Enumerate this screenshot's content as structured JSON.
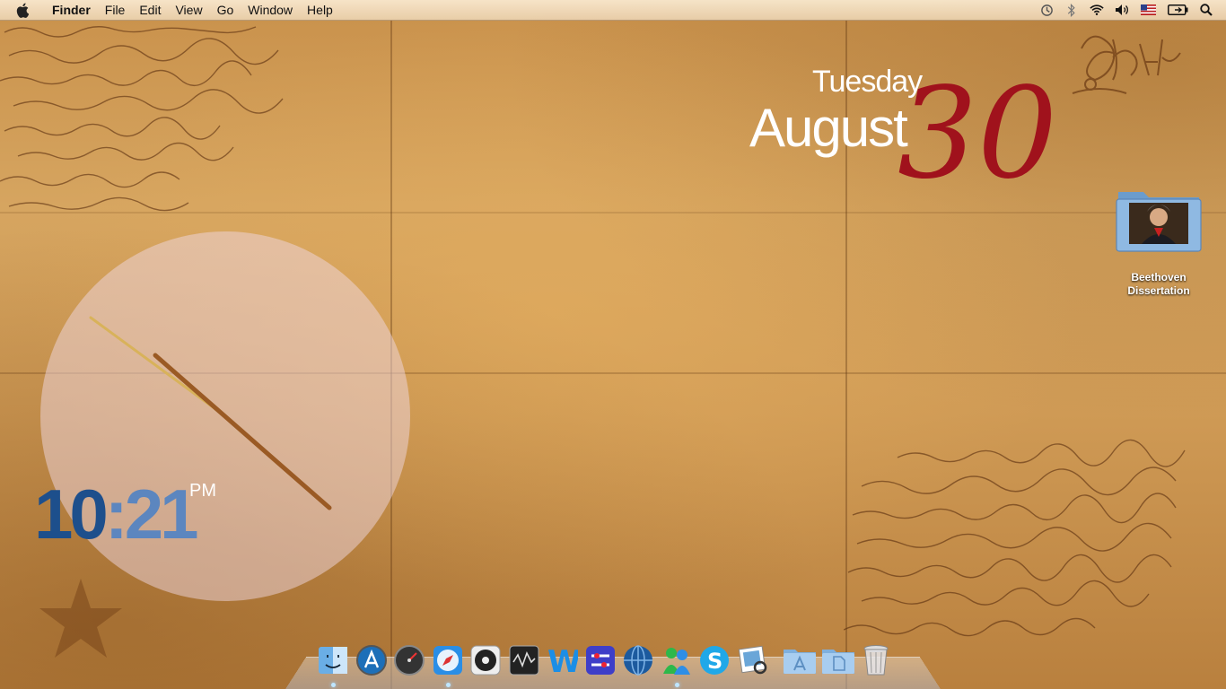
{
  "menubar": {
    "apple_icon": "apple-icon",
    "app_name": "Finder",
    "items": [
      "File",
      "Edit",
      "View",
      "Go",
      "Window",
      "Help"
    ],
    "status_icons": [
      "time-machine-icon",
      "bluetooth-icon",
      "wifi-icon",
      "volume-icon",
      "flag-icon",
      "battery-icon",
      "spotlight-icon"
    ]
  },
  "date_widget": {
    "day": "Tuesday,",
    "month": "August",
    "day_number": "30",
    "day_number_color": "#a0121c"
  },
  "clock_widget": {
    "hours": "10",
    "minutes_part": ":21",
    "ampm": "PM"
  },
  "desktop": {
    "folder": {
      "label_line1": "Beethoven",
      "label_line2": "Dissertation"
    }
  },
  "dock": {
    "apps": [
      {
        "name": "Finder",
        "icon": "finder-icon"
      },
      {
        "name": "App Store",
        "icon": "app-store-icon"
      },
      {
        "name": "Dashboard",
        "icon": "dashboard-icon"
      },
      {
        "name": "Safari",
        "icon": "safari-icon"
      },
      {
        "name": "iTunes",
        "icon": "itunes-icon"
      },
      {
        "name": "Activity",
        "icon": "activity-icon"
      },
      {
        "name": "Word",
        "icon": "word-icon"
      },
      {
        "name": "Settings",
        "icon": "settings-icon"
      },
      {
        "name": "Network",
        "icon": "network-icon"
      },
      {
        "name": "Messenger",
        "icon": "messenger-icon"
      },
      {
        "name": "Skype",
        "icon": "skype-icon"
      },
      {
        "name": "Preview",
        "icon": "preview-icon"
      }
    ],
    "stacks": [
      {
        "name": "Applications",
        "icon": "applications-folder-icon"
      },
      {
        "name": "Documents",
        "icon": "documents-folder-icon"
      },
      {
        "name": "Trash",
        "icon": "trash-icon"
      }
    ]
  },
  "colors": {
    "clock_hours": "#1d4f8c",
    "clock_minutes": "#5c86bf",
    "paper": "#cf9a55"
  }
}
